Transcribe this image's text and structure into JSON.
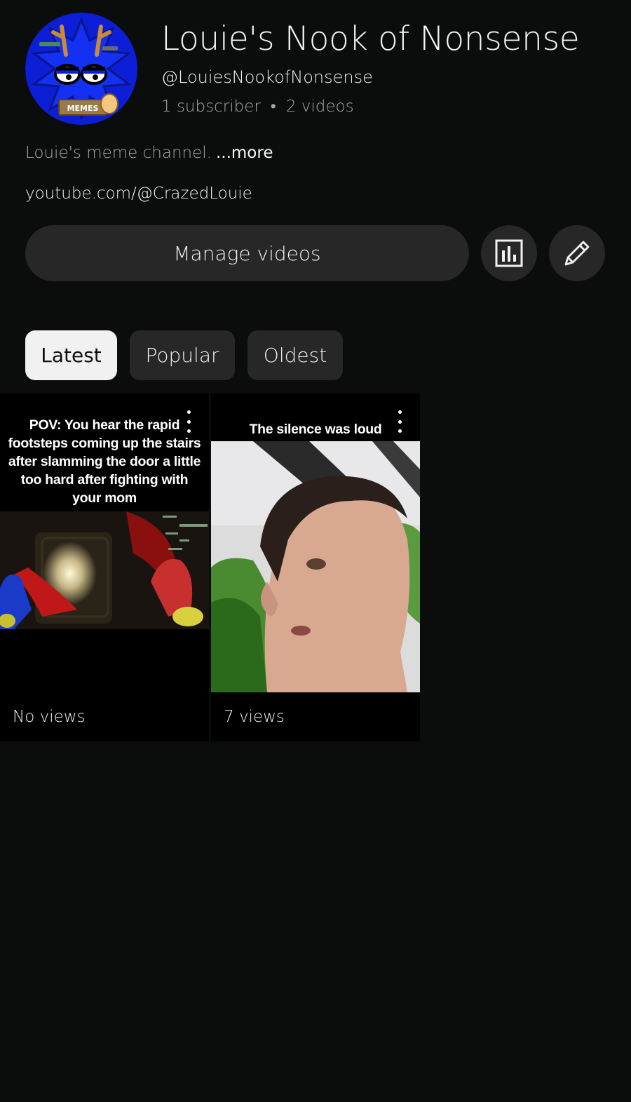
{
  "channel": {
    "name": "Louie's Nook of Nonsense",
    "handle": "@LouiesNookofNonsense",
    "subscribers": "1 subscriber",
    "separator": "•",
    "videos": "2 videos",
    "description": "Louie's meme channel.",
    "more_label": "...more",
    "link": "youtube.com/@CrazedLouie",
    "avatar_sign": "MEMES"
  },
  "actions": {
    "manage_label": "Manage videos",
    "analytics_icon": "bar-chart-icon",
    "edit_icon": "pencil-icon"
  },
  "filters": [
    {
      "label": "Latest",
      "selected": true
    },
    {
      "label": "Popular",
      "selected": false
    },
    {
      "label": "Oldest",
      "selected": false
    }
  ],
  "shorts": [
    {
      "caption": "POV: You hear the rapid footsteps coming up the stairs after slamming the door a little too hard after fighting with your mom",
      "views": "No views"
    },
    {
      "caption": "The silence was loud",
      "views": "7 views"
    }
  ]
}
